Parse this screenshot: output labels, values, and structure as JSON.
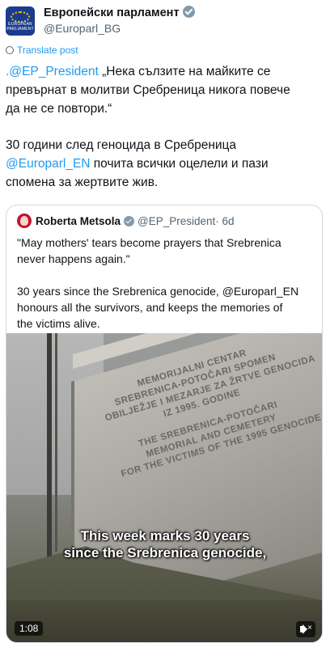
{
  "header": {
    "display_name": "Европейски парламент",
    "handle": "@Europarl_BG",
    "avatar_caption": "EUROPEAN PARLIAMENT"
  },
  "translate_label": "Translate post",
  "tweet": {
    "line1_mention": ".@EP_President",
    "line1_rest": " „Нека сълзите на майките се",
    "line2": "превърнат в молитви Сребреница никога повече",
    "line3": "да не се повтори.“",
    "line4": "30 години след геноцида в Сребреница",
    "line5_mention": "@Europarl_EN",
    "line5_rest": " почита всички оцелели и пази",
    "line6": "спомена за жертвите жив."
  },
  "quote": {
    "name": "Roberta Metsola",
    "handle": "@EP_President",
    "age": "· 6d",
    "line1": "\"May mothers' tears become prayers that Srebrenica",
    "line2": "never happens again.\"",
    "line3": "30 years since the Srebrenica genocide, @Europarl_EN",
    "line4": "honours all the survivors, and keeps the memories of",
    "line5": "the victims alive."
  },
  "video": {
    "engraving": [
      "MEMORIJALNI CENTAR",
      "SREBRENICA-POTOČARI SPOMEN",
      "OBILJEŽJE I MEZARJE ZA ŽRTVE GENOCIDA",
      "IZ 1995. GODINE",
      "THE SREBRENICA-POTOČARI",
      "MEMORIAL AND CEMETERY",
      "FOR THE VICTIMS OF THE 1995 GENOCIDE"
    ],
    "caption_line1": "This week marks 30 years",
    "caption_line2": "since the Srebrenica genocide,",
    "elapsed": "1:08",
    "mute_icon": "speaker-muted-icon"
  }
}
